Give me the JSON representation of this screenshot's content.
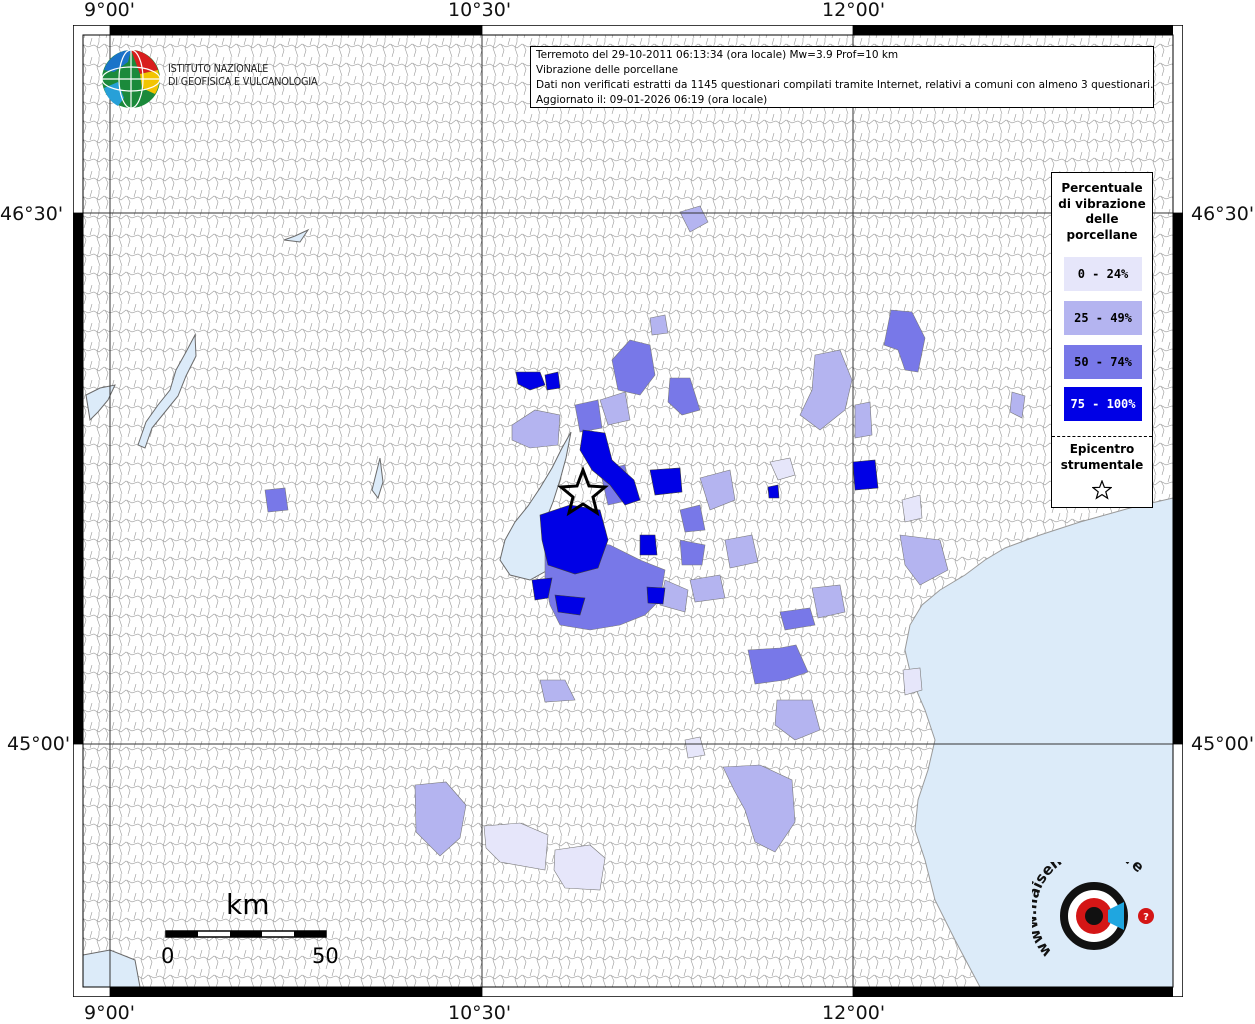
{
  "map": {
    "lon_labels": [
      "9°00'",
      "10°30'",
      "12°00'"
    ],
    "lat_labels": [
      "46°30'",
      "45°00'"
    ],
    "colors": {
      "sea": "#dcebf9",
      "lakes": "#dcebf9",
      "boundaries": "#9a9a9a",
      "class_0_24": "#e6e6fa",
      "class_25_49": "#b4b4f0",
      "class_50_74": "#7878e8",
      "class_75_100": "#0000e6"
    }
  },
  "info": {
    "line1": "Terremoto del 29-10-2011 06:13:34 (ora locale) Mw=3.9 Prof=10 km",
    "line2": "Vibrazione delle porcellane",
    "line3": "Dati non verificati estratti da 1145 questionari compilati tramite Internet, relativi a comuni con almeno 3 questionari.",
    "line4": "Aggiornato il: 09-01-2026 06:19 (ora locale)"
  },
  "legend": {
    "title_lines": [
      "Percentuale",
      "di vibrazione",
      "delle",
      "porcellane"
    ],
    "classes": [
      {
        "label": "0 - 24%",
        "color": "#e6e6fa",
        "text_color": "#000000"
      },
      {
        "label": "25 - 49%",
        "color": "#b4b4f0",
        "text_color": "#000000"
      },
      {
        "label": "50 - 74%",
        "color": "#7878e8",
        "text_color": "#000000"
      },
      {
        "label": "75 - 100%",
        "color": "#0000e6",
        "text_color": "#ffffff"
      }
    ],
    "epicenter_lines": [
      "Epicentro",
      "strumentale"
    ],
    "epicenter_icon": "star-outline-icon"
  },
  "logos": {
    "ingv_line1": "ISTITUTO NAZIONALE",
    "ingv_line2": "DI GEOFISICA E VULCANOLOGIA",
    "hsit_text": "www.haisentitoilterremoto.it"
  },
  "scale": {
    "title": "km",
    "start": "0",
    "end": "50"
  }
}
